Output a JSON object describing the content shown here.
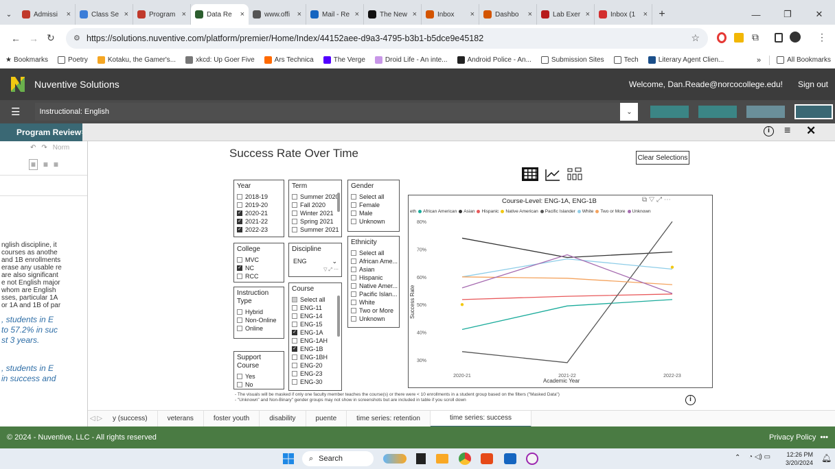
{
  "browser": {
    "tabs": [
      {
        "title": "Admissi",
        "color": "#c0392b"
      },
      {
        "title": "Class Se",
        "color": "#3b7dd8"
      },
      {
        "title": "Program",
        "color": "#c0392b"
      },
      {
        "title": "Data Re",
        "color": "#2c5e2e",
        "active": true
      },
      {
        "title": "www.offi",
        "color": "#555555"
      },
      {
        "title": "Mail - Re",
        "color": "#1565c0"
      },
      {
        "title": "The New",
        "color": "#111111"
      },
      {
        "title": "Inbox",
        "color": "#d35400"
      },
      {
        "title": "Dashbo",
        "color": "#d35400"
      },
      {
        "title": "Lab Exer",
        "color": "#b71c1c"
      },
      {
        "title": "Inbox (1",
        "color": "#d32f2f"
      }
    ],
    "url": "https://solutions.nuventive.com/platform/premier/Home/Index/44152aee-d9a3-4795-b3b1-b5dce9e45182",
    "bookmarks_label": "Bookmarks",
    "bookmarks": [
      {
        "label": "Poetry",
        "icon": "folder-icon"
      },
      {
        "label": "Kotaku, the Gamer's...",
        "icon": "kotaku-icon"
      },
      {
        "label": "xkcd: Up Goer Five",
        "icon": "xkcd-icon"
      },
      {
        "label": "Ars Technica",
        "icon": "ars-icon"
      },
      {
        "label": "The Verge",
        "icon": "verge-icon"
      },
      {
        "label": "Droid Life - An inte...",
        "icon": "droidlife-icon"
      },
      {
        "label": "Android Police - An...",
        "icon": "androidpolice-icon"
      },
      {
        "label": "Submission Sites",
        "icon": "folder-icon"
      },
      {
        "label": "Tech",
        "icon": "folder-icon"
      },
      {
        "label": "Literary Agent Clien...",
        "icon": "qt-icon"
      }
    ],
    "all_bookmarks": "All Bookmarks"
  },
  "app": {
    "name": "Nuventive Solutions",
    "welcome": "Welcome, Dan.Reade@norcocollege.edu!",
    "sign_out": "Sign out",
    "unit": "Instructional: English",
    "breadcrumb": "Program Review",
    "accent": "#3a6874"
  },
  "left_panel": {
    "toolbar_text": "Norm",
    "paragraph": [
      "nglish discipline, it",
      "courses as anothe",
      "and 1B enrollments",
      "erase any usable re",
      "are also significant",
      "e not English major",
      "whom are English",
      "sses, particular 1A",
      "or 1A and 1B of par"
    ],
    "italic1": [
      ", students in E",
      "to 57.2% in suc",
      "st 3 years."
    ],
    "italic2": [
      ", students in E",
      "in success and"
    ]
  },
  "report": {
    "title": "Success Rate Over Time",
    "clear_button": "Clear Selections",
    "note1": "- The visuals will be masked if only one faculty member teaches the course(s) or there were < 10 enrollments in a student group based on the filters (\"Masked Data\")",
    "note2": "- \"Unknown\" and Non-Binary\" gender groups may not show in screenshots but are included in table if you scroll down",
    "filters": {
      "year": {
        "title": "Year",
        "items": [
          {
            "label": "2018-19",
            "checked": false
          },
          {
            "label": "2019-20",
            "checked": false
          },
          {
            "label": "2020-21",
            "checked": true
          },
          {
            "label": "2021-22",
            "checked": true
          },
          {
            "label": "2022-23",
            "checked": true
          }
        ]
      },
      "term": {
        "title": "Term",
        "items": [
          {
            "label": "Summer 2020",
            "checked": false
          },
          {
            "label": "Fall 2020",
            "checked": false
          },
          {
            "label": "Winter 2021",
            "checked": false
          },
          {
            "label": "Spring 2021",
            "checked": false
          },
          {
            "label": "Summer 2021",
            "checked": false
          }
        ]
      },
      "gender": {
        "title": "Gender",
        "items": [
          {
            "label": "Select all",
            "checked": false
          },
          {
            "label": "Female",
            "checked": false
          },
          {
            "label": "Male",
            "checked": false
          },
          {
            "label": "Unknown",
            "checked": false
          }
        ]
      },
      "college": {
        "title": "College",
        "items": [
          {
            "label": "MVC",
            "checked": false
          },
          {
            "label": "NC",
            "checked": true
          },
          {
            "label": "RCC",
            "checked": false
          }
        ]
      },
      "discipline": {
        "title": "Discipline",
        "value": "ENG"
      },
      "ethnicity": {
        "title": "Ethnicity",
        "items": [
          {
            "label": "Select all",
            "checked": false
          },
          {
            "label": "African Ame...",
            "checked": false
          },
          {
            "label": "Asian",
            "checked": false
          },
          {
            "label": "Hispanic",
            "checked": false
          },
          {
            "label": "Native Amer...",
            "checked": false
          },
          {
            "label": "Pacific Islan...",
            "checked": false
          },
          {
            "label": "White",
            "checked": false
          },
          {
            "label": "Two or More",
            "checked": false
          },
          {
            "label": "Unknown",
            "checked": false
          }
        ]
      },
      "instruction": {
        "title": "Instruction Type",
        "items": [
          {
            "label": "Hybrid",
            "checked": false
          },
          {
            "label": "Non-Online",
            "checked": false
          },
          {
            "label": "Online",
            "checked": false
          }
        ]
      },
      "course": {
        "title": "Course",
        "items": [
          {
            "label": "Select all",
            "checked": "partial"
          },
          {
            "label": "ENG-11",
            "checked": false
          },
          {
            "label": "ENG-14",
            "checked": false
          },
          {
            "label": "ENG-15",
            "checked": false
          },
          {
            "label": "ENG-1A",
            "checked": true
          },
          {
            "label": "ENG-1AH",
            "checked": false
          },
          {
            "label": "ENG-1B",
            "checked": true
          },
          {
            "label": "ENG-1BH",
            "checked": false
          },
          {
            "label": "ENG-20",
            "checked": false
          },
          {
            "label": "ENG-23",
            "checked": false
          },
          {
            "label": "ENG-30",
            "checked": false
          }
        ]
      },
      "support": {
        "title": "Support Course",
        "items": [
          {
            "label": "Yes",
            "checked": false
          },
          {
            "label": "No",
            "checked": false
          }
        ]
      }
    }
  },
  "chart_data": {
    "type": "line",
    "title": "Course-Level: ENG-1A, ENG-1B",
    "legend_prefix": "eth",
    "xlabel": "Academic Year",
    "ylabel": "Success Rate",
    "x": [
      "2020-21",
      "2021-22",
      "2022-23"
    ],
    "yticks": [
      30,
      40,
      50,
      60,
      70,
      80
    ],
    "ylim": [
      27,
      82
    ],
    "series": [
      {
        "name": "African American",
        "color": "#1aab9b",
        "values": [
          41,
          49.5,
          51.8
        ]
      },
      {
        "name": "Asian",
        "color": "#333333",
        "values": [
          74,
          67,
          69
        ]
      },
      {
        "name": "Hispanic",
        "color": "#e8585a",
        "values": [
          51.8,
          53,
          53.8
        ]
      },
      {
        "name": "Native American",
        "color": "#f2c811",
        "values": [
          50,
          null,
          63.5
        ]
      },
      {
        "name": "Pacific Islander",
        "color": "#555555",
        "values": [
          33,
          29,
          80
        ]
      },
      {
        "name": "White",
        "color": "#8ecde8",
        "values": [
          60,
          66.5,
          62.8
        ]
      },
      {
        "name": "Two or More",
        "color": "#f4a35e",
        "values": [
          60,
          59.5,
          57.2
        ]
      },
      {
        "name": "Unknown",
        "color": "#a66bb0",
        "values": [
          56,
          68,
          54
        ]
      }
    ]
  },
  "bottom_tabs": [
    "y (success)",
    "veterans",
    "foster youth",
    "disability",
    "puente",
    "time series: retention",
    "time series: success"
  ],
  "footer": {
    "copyright": "© 2024 - Nuventive, LLC - All rights reserved",
    "privacy": "Privacy Policy"
  },
  "taskbar": {
    "search": "Search",
    "time": "12:26 PM",
    "date": "3/20/2024"
  }
}
